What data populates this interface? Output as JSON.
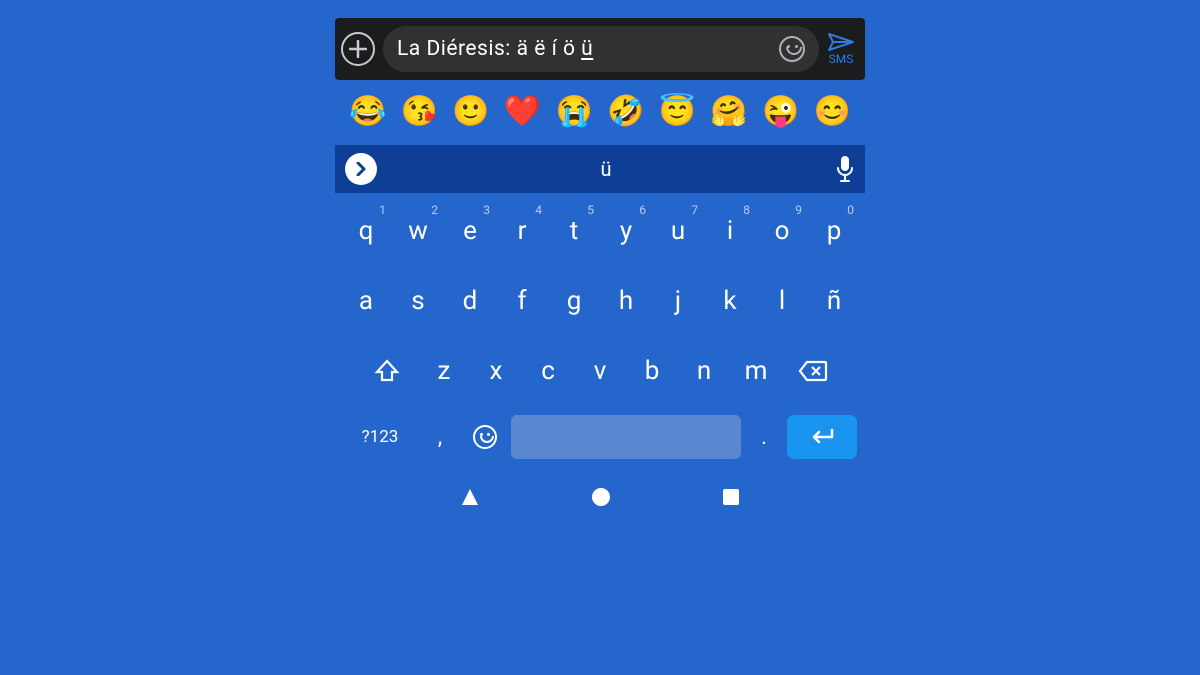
{
  "compose": {
    "text_main": "La Diéresis: ä ë í ö ",
    "text_underlined": "ü",
    "send_label": "SMS"
  },
  "emoji_strip": [
    "😂",
    "😘",
    "🙂",
    "❤️",
    "😭",
    "🤣",
    "😇",
    "🤗",
    "😜",
    "😊"
  ],
  "suggestion": {
    "center": "ü"
  },
  "keyboard": {
    "row1": [
      {
        "k": "q",
        "h": "1"
      },
      {
        "k": "w",
        "h": "2"
      },
      {
        "k": "e",
        "h": "3"
      },
      {
        "k": "r",
        "h": "4"
      },
      {
        "k": "t",
        "h": "5"
      },
      {
        "k": "y",
        "h": "6"
      },
      {
        "k": "u",
        "h": "7"
      },
      {
        "k": "i",
        "h": "8"
      },
      {
        "k": "o",
        "h": "9"
      },
      {
        "k": "p",
        "h": "0"
      }
    ],
    "row2": [
      "a",
      "s",
      "d",
      "f",
      "g",
      "h",
      "j",
      "k",
      "l",
      "ñ"
    ],
    "row3": [
      "z",
      "x",
      "c",
      "v",
      "b",
      "n",
      "m"
    ],
    "symbols_label": "?123",
    "comma": ",",
    "period": "."
  }
}
